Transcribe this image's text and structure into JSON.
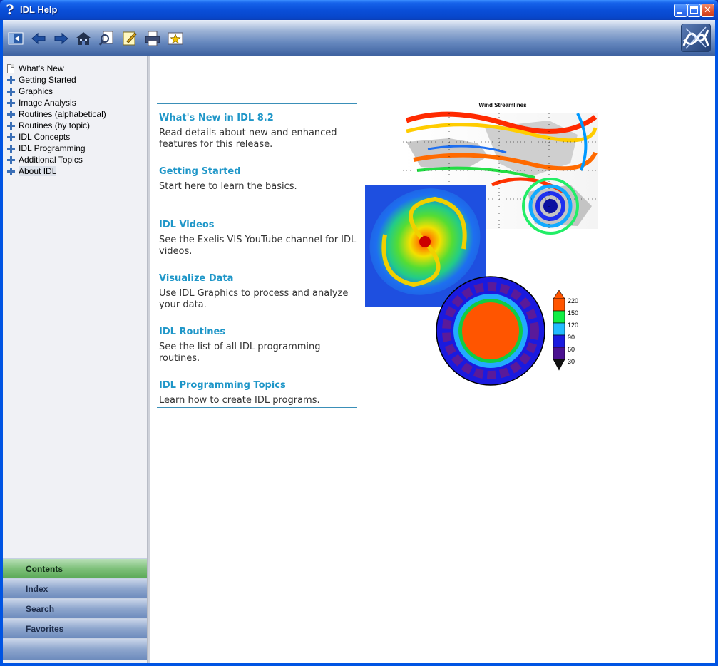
{
  "window": {
    "title": "IDL Help",
    "title_icon": "?",
    "close_glyph": "✕"
  },
  "toolbar": {
    "buttons": [
      {
        "name": "hide-navigation-icon"
      },
      {
        "name": "back-icon"
      },
      {
        "name": "forward-icon"
      },
      {
        "name": "home-icon"
      },
      {
        "name": "find-icon"
      },
      {
        "name": "edit-icon"
      },
      {
        "name": "print-icon"
      },
      {
        "name": "add-favorite-icon"
      }
    ],
    "logo": "idl-logo-icon"
  },
  "sidebar": {
    "tree": [
      {
        "label": "What's New",
        "type": "page"
      },
      {
        "label": "Getting Started",
        "type": "book"
      },
      {
        "label": "Graphics",
        "type": "book"
      },
      {
        "label": "Image Analysis",
        "type": "book"
      },
      {
        "label": "Routines (alphabetical)",
        "type": "book"
      },
      {
        "label": "Routines (by topic)",
        "type": "book"
      },
      {
        "label": "IDL Concepts",
        "type": "book"
      },
      {
        "label": "IDL Programming",
        "type": "book"
      },
      {
        "label": "Additional Topics",
        "type": "book"
      },
      {
        "label": "About IDL",
        "type": "book",
        "selected": true
      }
    ],
    "tabs": [
      {
        "label": "Contents",
        "active": true
      },
      {
        "label": "Index"
      },
      {
        "label": "Search"
      },
      {
        "label": "Favorites"
      }
    ]
  },
  "content": {
    "links": [
      {
        "title": "What's New in IDL 8.2",
        "desc": "Read details about new and enhanced features for this release."
      },
      {
        "title": "Getting Started",
        "desc": "Start here to learn the basics."
      },
      {
        "title": "IDL Videos",
        "desc": "See the Exelis VIS YouTube channel for IDL videos."
      },
      {
        "title": "Visualize Data",
        "desc": "Use IDL Graphics to process and analyze your data."
      },
      {
        "title": "IDL Routines",
        "desc": "See the list of all IDL programming routines."
      },
      {
        "title": "IDL Programming Topics",
        "desc": "Learn how to create IDL programs."
      }
    ],
    "figure": {
      "map_title": "Wind Streamlines",
      "colorbar_labels": [
        "220",
        "150",
        "120",
        "90",
        "60",
        "30"
      ]
    }
  },
  "colors": {
    "link": "#1e96c8",
    "rule": "#3a8fb8",
    "title_bar": "#0a4fd9"
  }
}
